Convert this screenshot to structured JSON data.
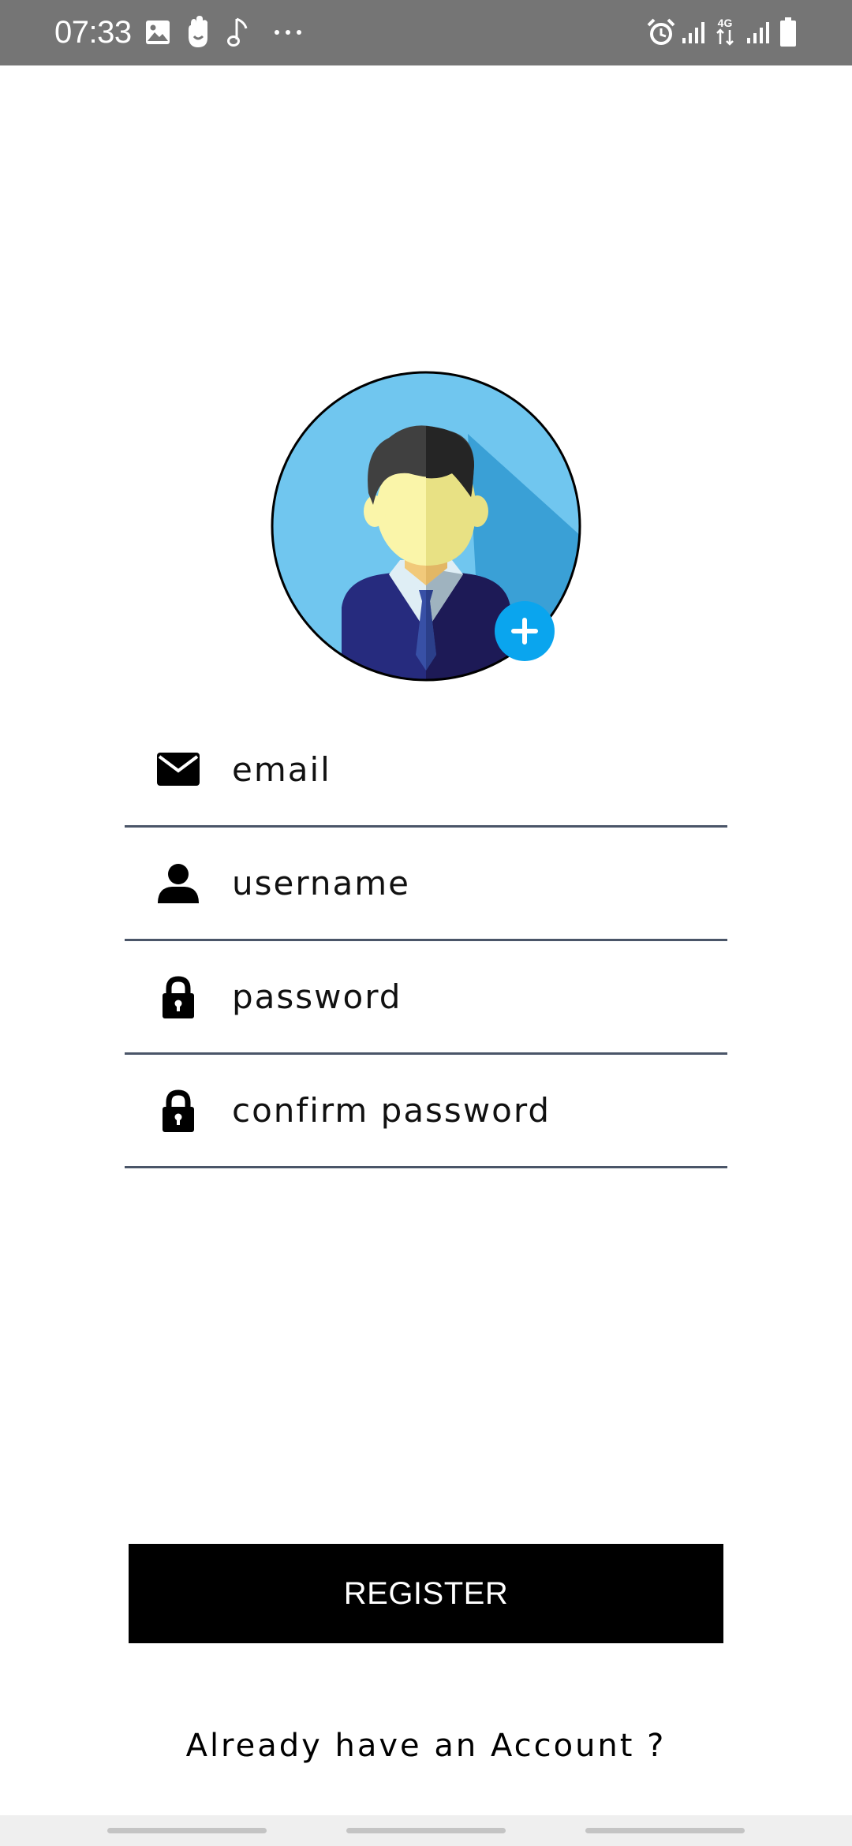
{
  "status_bar": {
    "time": "07:33",
    "left_icons": [
      "gallery-icon",
      "hand-icon",
      "music-note-icon",
      "more-icon"
    ],
    "right_icons": [
      "alarm-icon",
      "signal-icon",
      "4g-data-icon",
      "signal-icon",
      "battery-icon"
    ],
    "network_label": "4G"
  },
  "avatar": {
    "icon": "user-avatar",
    "add_icon": "add-photo-icon"
  },
  "form": {
    "email": {
      "placeholder": "email",
      "icon": "envelope-icon"
    },
    "username": {
      "placeholder": "username",
      "icon": "person-icon"
    },
    "password": {
      "placeholder": "password",
      "icon": "lock-icon"
    },
    "confirm_password": {
      "placeholder": "confirm password",
      "icon": "lock-icon"
    }
  },
  "register_button": {
    "label": "REGISTER"
  },
  "login_link": {
    "label": "Already have an Account ?"
  },
  "colors": {
    "status_bar": "#757575",
    "button_bg": "#000000",
    "underline": "#4a5568",
    "avatar_bg": "#70c6ef",
    "add_badge": "#0aa5ee"
  }
}
